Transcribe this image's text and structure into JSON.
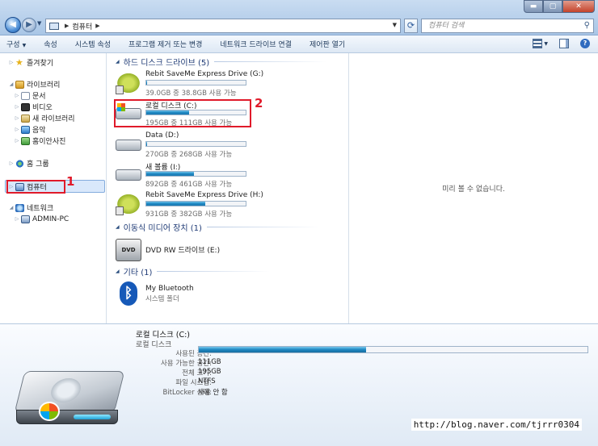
{
  "address": {
    "path": "컴퓨터",
    "search_placeholder": "컴퓨터 검색"
  },
  "toolbar": {
    "items": [
      "구성",
      "속성",
      "시스템 속성",
      "프로그램 제거 또는 변경",
      "네트워크 드라이브 연결",
      "제어판 열기"
    ]
  },
  "nav": {
    "favorites": "즐겨찾기",
    "libraries": "라이브러리",
    "documents": "문서",
    "videos": "비디오",
    "new_library": "새 라이브러리",
    "music": "음악",
    "pictures": "홈이안사진",
    "homegroup": "홈 그룹",
    "computer": "컴퓨터",
    "network": "네트워크",
    "admin_pc": "ADMIN-PC"
  },
  "annotations": {
    "one": "1",
    "two": "2"
  },
  "groups": {
    "hdd": "하드 디스크 드라이브 (5)",
    "removable": "이동식 미디어 장치 (1)",
    "other": "기타 (1)"
  },
  "drives": [
    {
      "name": "Rebit SaveMe Express Drive (G:)",
      "size": "39.0GB 중 38.8GB 사용 가능",
      "used_fraction": 0.005,
      "icon": "usb-drive-icon"
    },
    {
      "name": "로컬 디스크 (C:)",
      "size": "195GB 중 111GB 사용 가능",
      "used_fraction": 0.43,
      "icon": "windows-drive-icon"
    },
    {
      "name": "Data (D:)",
      "size": "270GB 중 268GB 사용 가능",
      "used_fraction": 0.007,
      "icon": "hard-drive-icon"
    },
    {
      "name": "새 볼륨 (I:)",
      "size": "892GB 중 461GB 사용 가능",
      "used_fraction": 0.48,
      "icon": "hard-drive-icon"
    },
    {
      "name": "Rebit SaveMe Express Drive (H:)",
      "size": "931GB 중 382GB 사용 가능",
      "used_fraction": 0.59,
      "icon": "usb-drive-icon"
    }
  ],
  "dvd": {
    "name": "DVD RW 드라이브 (E:)",
    "label": "DVD"
  },
  "bluetooth": {
    "name": "My Bluetooth",
    "type": "시스템 폴더"
  },
  "preview": {
    "text": "미리 볼 수 없습니다."
  },
  "details": {
    "title": "로컬 디스크 (C:)",
    "subtitle": "로컬 디스크",
    "used_label": "사용된 공간:",
    "used_fraction": 0.43,
    "free_label": "사용 가능한 공간:",
    "free_value": "111GB",
    "total_label": "전체 크기:",
    "total_value": "195GB",
    "fs_label": "파일 시스템:",
    "fs_value": "NTFS",
    "bitlocker_label": "BitLocker 상태:",
    "bitlocker_value": "사용 안 함"
  },
  "watermark": "http://blog.naver.com/tjrrr0304"
}
